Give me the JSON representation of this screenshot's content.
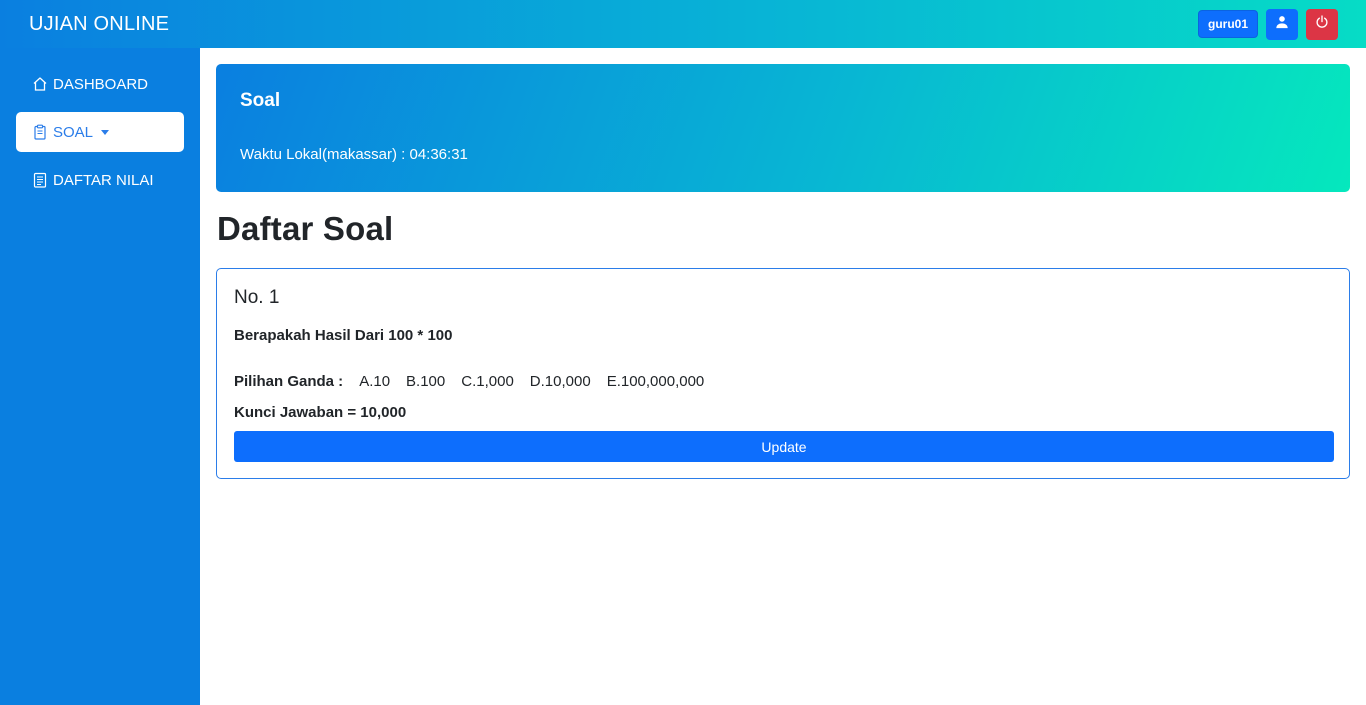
{
  "header": {
    "brand": "UJIAN ONLINE",
    "user": "guru01",
    "profile_icon": "user-icon",
    "logout_icon": "power-icon"
  },
  "sidebar": {
    "items": [
      {
        "label": "DASHBOARD",
        "icon": "home-icon",
        "active": false
      },
      {
        "label": "SOAL",
        "icon": "clipboard-icon",
        "active": true
      },
      {
        "label": "DAFTAR NILAI",
        "icon": "document-icon",
        "active": false
      }
    ]
  },
  "hero": {
    "title": "Soal",
    "time_text": "Waktu Lokal(makassar) : 04:36:31"
  },
  "page": {
    "title": "Daftar Soal"
  },
  "question": {
    "number": "No. 1",
    "text": "Berapakah Hasil Dari 100 * 100",
    "options_label": "Pilihan Ganda :",
    "options": [
      "A.10",
      "B.100",
      "C.1,000",
      "D.10,000",
      "E.100,000,000"
    ],
    "answer_key": "Kunci Jawaban = 10,000",
    "update_label": "Update"
  },
  "colors": {
    "primary": "#0d6efd",
    "danger": "#dc3545",
    "sidebar": "#0a7fe0",
    "gradient_end": "#05e8bd"
  }
}
